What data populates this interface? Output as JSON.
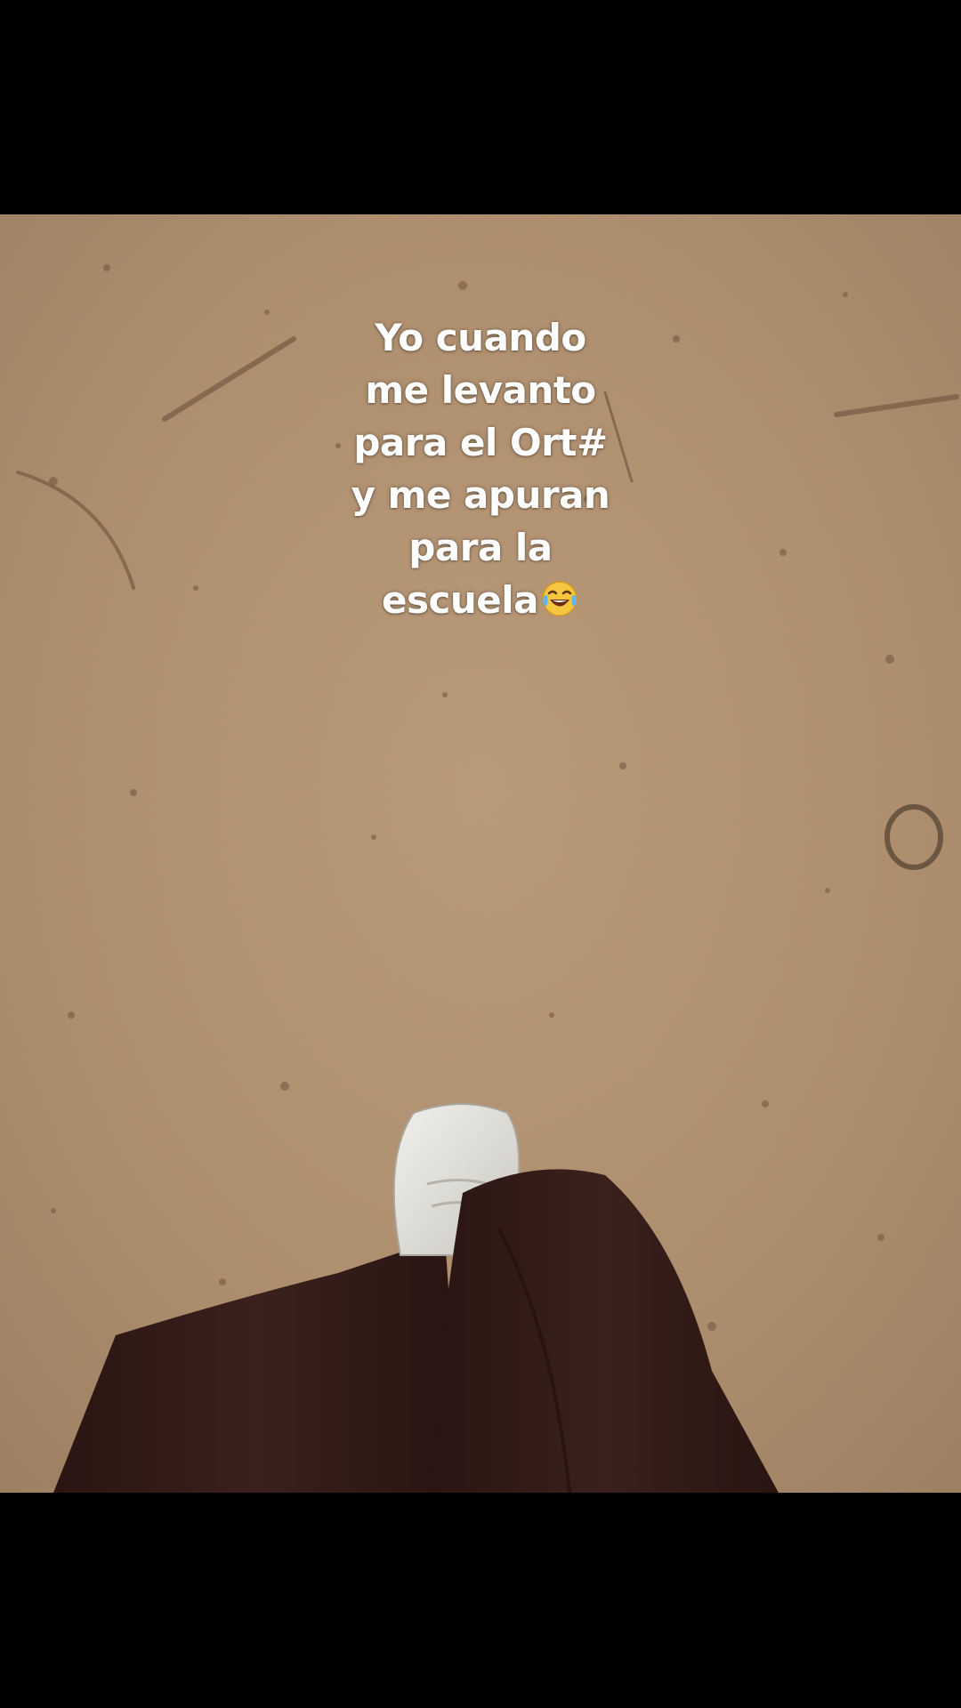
{
  "caption": {
    "lines": [
      "Yo cuando",
      "me levanto",
      "para el Ort#",
      "y me apuran",
      "para la",
      "escuela"
    ],
    "emoji": "face-with-tears-of-joy-icon"
  },
  "scene": {
    "subject": "white sneaker and dark brown trouser leg stepping on dirt ground",
    "colors": {
      "ground": "#b89673",
      "ground_dark": "#8c7057",
      "trousers": "#2e1915",
      "sneaker": "#e3e1dc",
      "letterbox": "#000000",
      "caption_text": "#ffffff"
    }
  }
}
